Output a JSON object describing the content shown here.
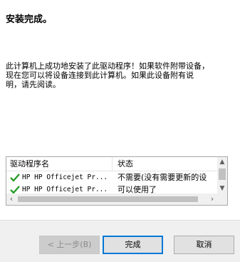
{
  "wizard": {
    "title": "安装完成。",
    "description_lines": [
      "此计算机上成功地安装了此驱动程序！如果软件附带设备，",
      "现在您可以将设备连接到此计算机。如果此设备附有说",
      "明，请先阅读。"
    ]
  },
  "driver_list": {
    "columns": [
      "驱动程序名",
      "状态"
    ],
    "rows": [
      {
        "name": "HP HP Officejet Pr...",
        "status": "不需要(没有需要更新的设",
        "icon": "checkmark-icon"
      },
      {
        "name": "HP HP Officejet Pr...",
        "status": "可以使用了",
        "icon": "checkmark-icon"
      }
    ]
  },
  "buttons": {
    "back": "< 上一步(B)",
    "finish": "完成",
    "cancel": "取消"
  },
  "colors": {
    "checkmark": "#2a9d2a",
    "focus_border": "#0078d7"
  }
}
